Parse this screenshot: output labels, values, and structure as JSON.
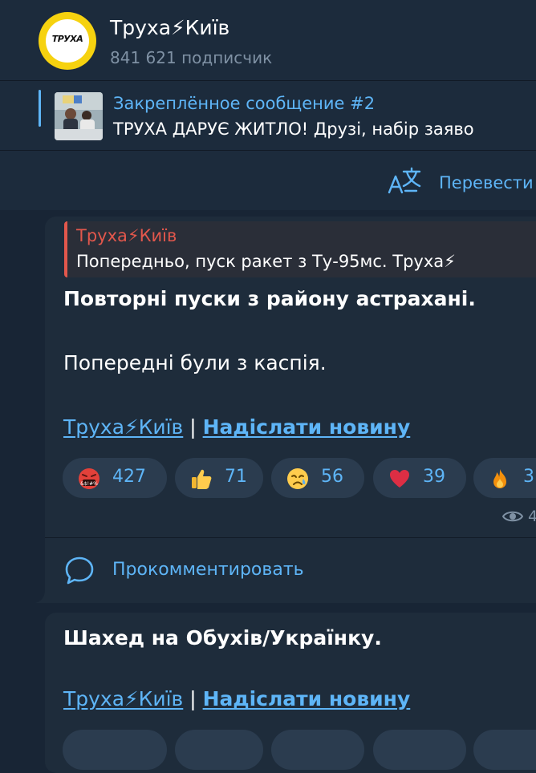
{
  "channel": {
    "name": "Труха⚡Київ",
    "subscribers": "841 621 подписчик",
    "avatar_text": "ТРУХА"
  },
  "pinned": {
    "title": "Закреплённое сообщение #2",
    "text": "ТРУХА ДАРУЄ ЖИТЛО!  Друзі, набір заяво"
  },
  "translate": {
    "label": "Перевести",
    "icon": "translate-icon"
  },
  "messages": [
    {
      "quote": {
        "author": "Труха⚡Київ",
        "text": "Попередньо, пуск ракет з Ту-95мс.  Труха⚡"
      },
      "headline": "Повторні пуски з району астрахані.",
      "body": "Попередні були з каспія.",
      "signature": {
        "channel_link": "Труха⚡Київ",
        "separator": "|",
        "news_link": "Надіслати новину"
      },
      "reactions": [
        {
          "emoji": "swearing-face",
          "count": "427"
        },
        {
          "emoji": "thumbs-up",
          "count": "71"
        },
        {
          "emoji": "crying-face",
          "count": "56"
        },
        {
          "emoji": "red-heart",
          "count": "39"
        },
        {
          "emoji": "fire",
          "count": "3"
        }
      ],
      "views": "4",
      "comment_label": "Прокомментировать"
    },
    {
      "headline": "Шахед на Обухів/Українку.",
      "signature": {
        "channel_link": "Труха⚡Київ",
        "separator": "|",
        "news_link": "Надіслати новину"
      }
    }
  ],
  "colors": {
    "background": "#182535",
    "panel": "#1c2b3c",
    "bubble": "#1e2c3b",
    "accent": "#5eb5f7",
    "quote_accent": "#e2574c",
    "muted": "#7f91a4"
  }
}
